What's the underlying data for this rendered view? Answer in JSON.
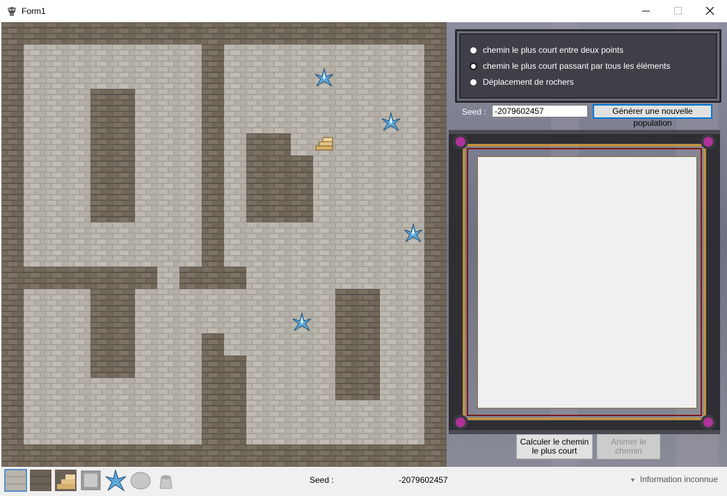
{
  "window": {
    "title": "Form1"
  },
  "modes": {
    "items": [
      {
        "label": "chemin le plus court entre deux points",
        "selected": false
      },
      {
        "label": "chemin le plus court passant par tous les éléments",
        "selected": true
      },
      {
        "label": "Déplacement de rochers",
        "selected": false
      }
    ]
  },
  "seed": {
    "label": "Seed :",
    "value": "-2079602457"
  },
  "buttons": {
    "generate": "Générer une nouvelle population",
    "calculate": "Calculer le chemin le plus court",
    "animate": "Animer le chemin",
    "animate_enabled": false
  },
  "statusbar": {
    "seed_label": "Seed :",
    "seed_value": "-2079602457",
    "info": "Information inconnue",
    "tools": [
      "floor-tile-icon",
      "wall-tile-icon",
      "stairs-tile-icon",
      "door-tile-icon",
      "crystal-tile-icon",
      "rock-tile-icon",
      "pot-tile-icon"
    ]
  },
  "map": {
    "cols": 20,
    "rows": 20,
    "legend": {
      "#": "wall",
      ".": "floor"
    },
    "grid": [
      "####################",
      "#........#.........#",
      "#........#.........#",
      "#...##...#.........#",
      "#...##...#.........#",
      "#...##...#.##......#",
      "#...##...#.###.....#",
      "#...##...#.###.....#",
      "#...##...#.###.....#",
      "#........#.........#",
      "#........#.........#",
      "#######.###........#",
      "#...##.........##..#",
      "#...##.........##..#",
      "#...##...#.....##..#",
      "#...##...##....##..#",
      "#........##....##..#",
      "#........##........#",
      "#........##........#",
      "####################"
    ],
    "items": [
      {
        "type": "crystal",
        "col": 14,
        "row": 2
      },
      {
        "type": "crystal",
        "col": 17,
        "row": 4
      },
      {
        "type": "stairs",
        "col": 14,
        "row": 5
      },
      {
        "type": "crystal",
        "col": 18,
        "row": 9
      },
      {
        "type": "crystal",
        "col": 13,
        "row": 13
      }
    ]
  },
  "colors": {
    "wall": "#6a6156",
    "floor": "#b8b4ac",
    "crystal": "#5fa8d8",
    "stairs": "#d6b06a",
    "accent": "#0078d7"
  }
}
